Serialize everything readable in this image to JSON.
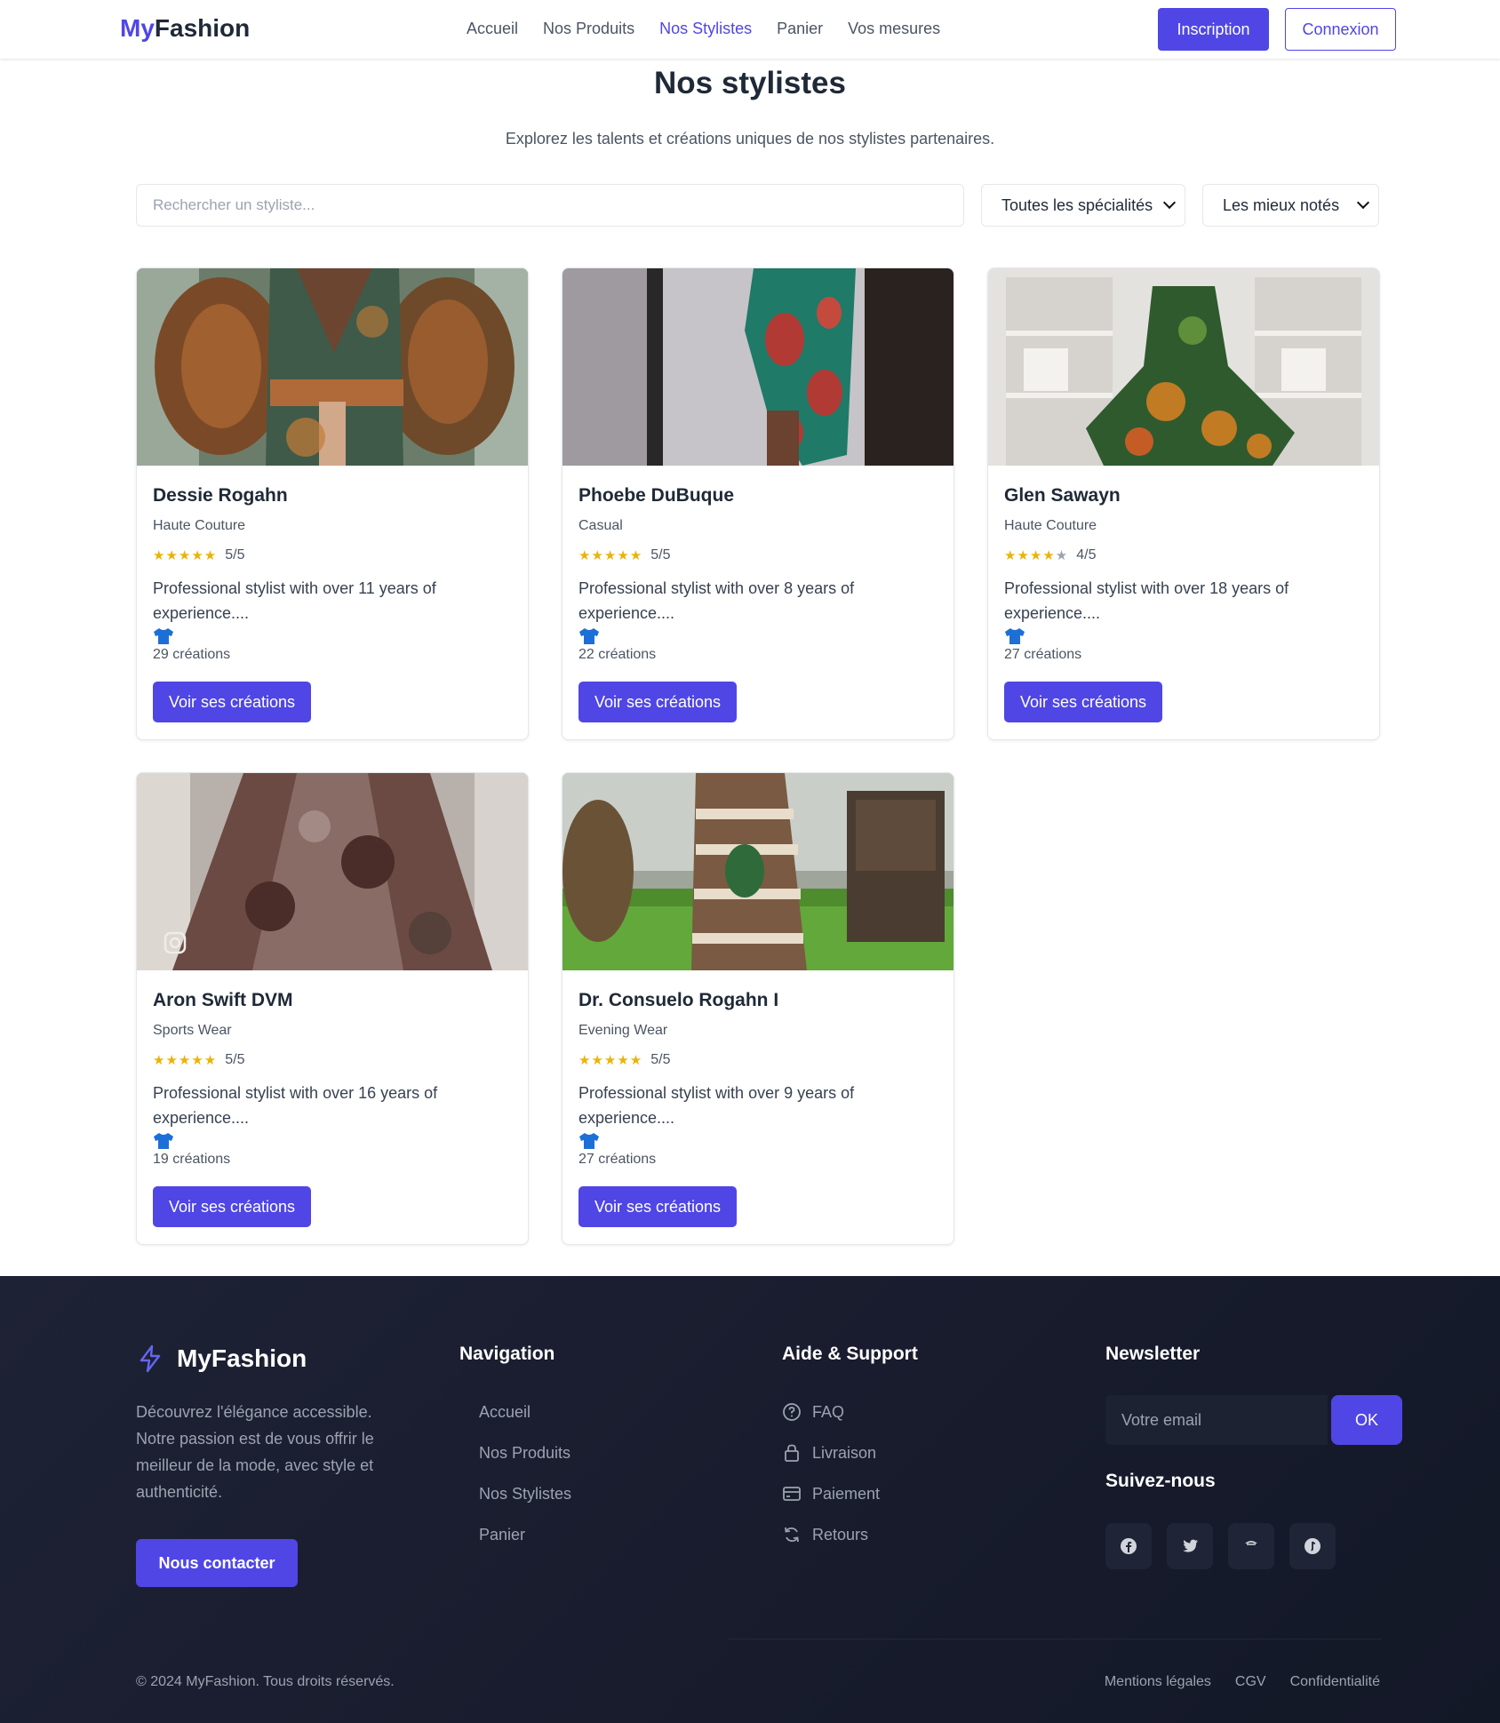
{
  "header": {
    "logo_part1": "My",
    "logo_part2": "Fashion",
    "nav": [
      "Accueil",
      "Nos Produits",
      "Nos Stylistes",
      "Panier",
      "Vos mesures"
    ],
    "active_nav": "Nos Stylistes",
    "signup_label": "Inscription",
    "login_label": "Connexion"
  },
  "page": {
    "title": "Nos stylistes",
    "subtitle": "Explorez les talents et créations uniques de nos stylistes partenaires."
  },
  "filters": {
    "search_placeholder": "Rechercher un styliste...",
    "specialty_selected": "Toutes les spécialités",
    "sort_selected": "Les mieux notés"
  },
  "stylists": [
    {
      "name": "Dessie Rogahn",
      "specialty": "Haute Couture",
      "stars": 5,
      "rating": "5/5",
      "description": "Professional stylist with over 11 years of experience....",
      "creations": "29 créations",
      "button": "Voir ses créations"
    },
    {
      "name": "Phoebe DuBuque",
      "specialty": "Casual",
      "stars": 5,
      "rating": "5/5",
      "description": "Professional stylist with over 8 years of experience....",
      "creations": "22 créations",
      "button": "Voir ses créations"
    },
    {
      "name": "Glen Sawayn",
      "specialty": "Haute Couture",
      "stars": 4,
      "rating": "4/5",
      "description": "Professional stylist with over 18 years of experience....",
      "creations": "27 créations",
      "button": "Voir ses créations"
    },
    {
      "name": "Aron Swift DVM",
      "specialty": "Sports Wear",
      "stars": 5,
      "rating": "5/5",
      "description": "Professional stylist with over 16 years of experience....",
      "creations": "19 créations",
      "button": "Voir ses créations"
    },
    {
      "name": "Dr. Consuelo Rogahn I",
      "specialty": "Evening Wear",
      "stars": 5,
      "rating": "5/5",
      "description": "Professional stylist with over 9 years of experience....",
      "creations": "27 créations",
      "button": "Voir ses créations"
    }
  ],
  "footer": {
    "brand": "MyFashion",
    "about": "Découvrez l'élégance accessible. Notre passion est de vous offrir le meilleur de la mode, avec style et authenticité.",
    "contact_button": "Nous contacter",
    "navigation_title": "Navigation",
    "navigation": [
      "Accueil",
      "Nos Produits",
      "Nos Stylistes",
      "Panier"
    ],
    "support_title": "Aide & Support",
    "support": [
      {
        "icon": "question-circle-icon",
        "label": "FAQ"
      },
      {
        "icon": "lock-icon",
        "label": "Livraison"
      },
      {
        "icon": "credit-card-icon",
        "label": "Paiement"
      },
      {
        "icon": "refresh-icon",
        "label": "Retours"
      }
    ],
    "newsletter_title": "Newsletter",
    "newsletter_placeholder": "Votre email",
    "newsletter_button": "OK",
    "social_title": "Suivez-nous",
    "social": [
      "facebook-icon",
      "twitter-icon",
      "instagram-icon",
      "tiktok-icon"
    ],
    "copyright": "© 2024 MyFashion. Tous droits réservés.",
    "legal": [
      "Mentions légales",
      "CGV",
      "Confidentialité"
    ]
  },
  "colors": {
    "primary": "#4f46e5",
    "star": "#eab308",
    "footer_bg": "#1a1f31",
    "shirt_icon": "#1d6fd8"
  }
}
